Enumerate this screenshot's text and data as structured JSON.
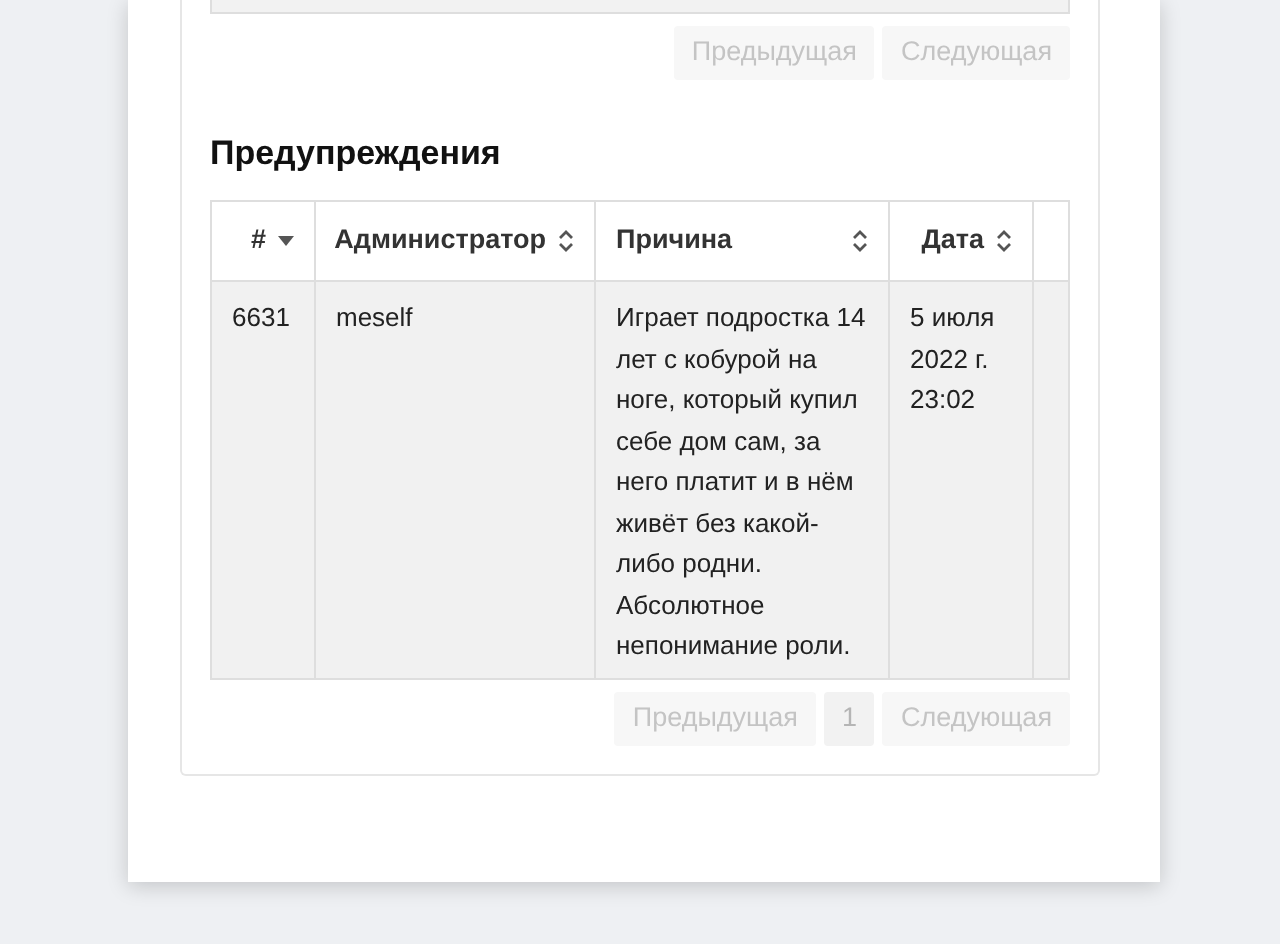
{
  "top_pagination": [
    {
      "label": "Предыдущая",
      "disabled": true
    },
    {
      "label": "Следующая",
      "disabled": true
    }
  ],
  "section_title": "Предупреждения",
  "table": {
    "columns": [
      {
        "label": "#",
        "sorted": true
      },
      {
        "label": "Администратор",
        "sorted": false
      },
      {
        "label": "Причина",
        "sorted": false
      },
      {
        "label": "Дата",
        "sorted": false
      }
    ],
    "rows": [
      {
        "cells": [
          "6631",
          "meself",
          "Играет подростка 14 лет с кобурой на ноге, который купил себе дом сам, за него платит и в нём живёт без какой-либо родни. Абсолютное непонимание роли.",
          "5 июля 2022 г. 23:02"
        ]
      }
    ]
  },
  "pagination": [
    {
      "label": "Предыдущая",
      "disabled": true,
      "selected": false
    },
    {
      "label": "1",
      "disabled": false,
      "selected": true
    },
    {
      "label": "Следующая",
      "disabled": true,
      "selected": false
    }
  ]
}
